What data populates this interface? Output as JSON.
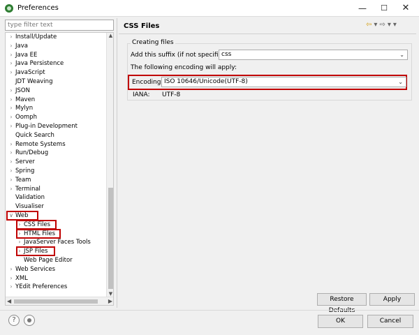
{
  "window": {
    "title": "Preferences",
    "icon": "eclipse-icon"
  },
  "filter": {
    "placeholder": "type filter text",
    "value": ""
  },
  "tree": [
    {
      "label": "Install/Update",
      "expandable": true,
      "level": 0
    },
    {
      "label": "Java",
      "expandable": true,
      "level": 0
    },
    {
      "label": "Java EE",
      "expandable": true,
      "level": 0
    },
    {
      "label": "Java Persistence",
      "expandable": true,
      "level": 0
    },
    {
      "label": "JavaScript",
      "expandable": true,
      "level": 0
    },
    {
      "label": "JDT Weaving",
      "expandable": false,
      "level": 0
    },
    {
      "label": "JSON",
      "expandable": true,
      "level": 0
    },
    {
      "label": "Maven",
      "expandable": true,
      "level": 0
    },
    {
      "label": "Mylyn",
      "expandable": true,
      "level": 0
    },
    {
      "label": "Oomph",
      "expandable": true,
      "level": 0
    },
    {
      "label": "Plug-in Development",
      "expandable": true,
      "level": 0
    },
    {
      "label": "Quick Search",
      "expandable": false,
      "level": 0
    },
    {
      "label": "Remote Systems",
      "expandable": true,
      "level": 0
    },
    {
      "label": "Run/Debug",
      "expandable": true,
      "level": 0
    },
    {
      "label": "Server",
      "expandable": true,
      "level": 0
    },
    {
      "label": "Spring",
      "expandable": true,
      "level": 0
    },
    {
      "label": "Team",
      "expandable": true,
      "level": 0
    },
    {
      "label": "Terminal",
      "expandable": true,
      "level": 0
    },
    {
      "label": "Validation",
      "expandable": false,
      "level": 0
    },
    {
      "label": "Visualiser",
      "expandable": false,
      "level": 0
    },
    {
      "label": "Web",
      "expandable": true,
      "expanded": true,
      "level": 0
    },
    {
      "label": "CSS Files",
      "expandable": true,
      "level": 1,
      "selected": true
    },
    {
      "label": "HTML Files",
      "expandable": true,
      "level": 1
    },
    {
      "label": "JavaServer Faces Tools",
      "expandable": true,
      "level": 1
    },
    {
      "label": "JSP Files",
      "expandable": true,
      "level": 1
    },
    {
      "label": "Web Page Editor",
      "expandable": false,
      "level": 1
    },
    {
      "label": "Web Services",
      "expandable": true,
      "level": 0
    },
    {
      "label": "XML",
      "expandable": true,
      "level": 0
    },
    {
      "label": "YEdit Preferences",
      "expandable": true,
      "level": 0
    }
  ],
  "page": {
    "title": "CSS Files",
    "group_label": "Creating files",
    "suffix_label": "Add this suffix (if not specified):",
    "suffix_value": "css",
    "encoding_note": "The following encoding will apply:",
    "encoding_label": "Encoding:",
    "encoding_value": "ISO 10646/Unicode(UTF-8)",
    "iana_label": "IANA:",
    "iana_value": "UTF-8"
  },
  "buttons": {
    "restore_defaults": "Restore Defaults",
    "apply": "Apply",
    "ok": "OK",
    "cancel": "Cancel"
  },
  "colors": {
    "highlight": "#c00000",
    "selected_text": "#000000"
  }
}
